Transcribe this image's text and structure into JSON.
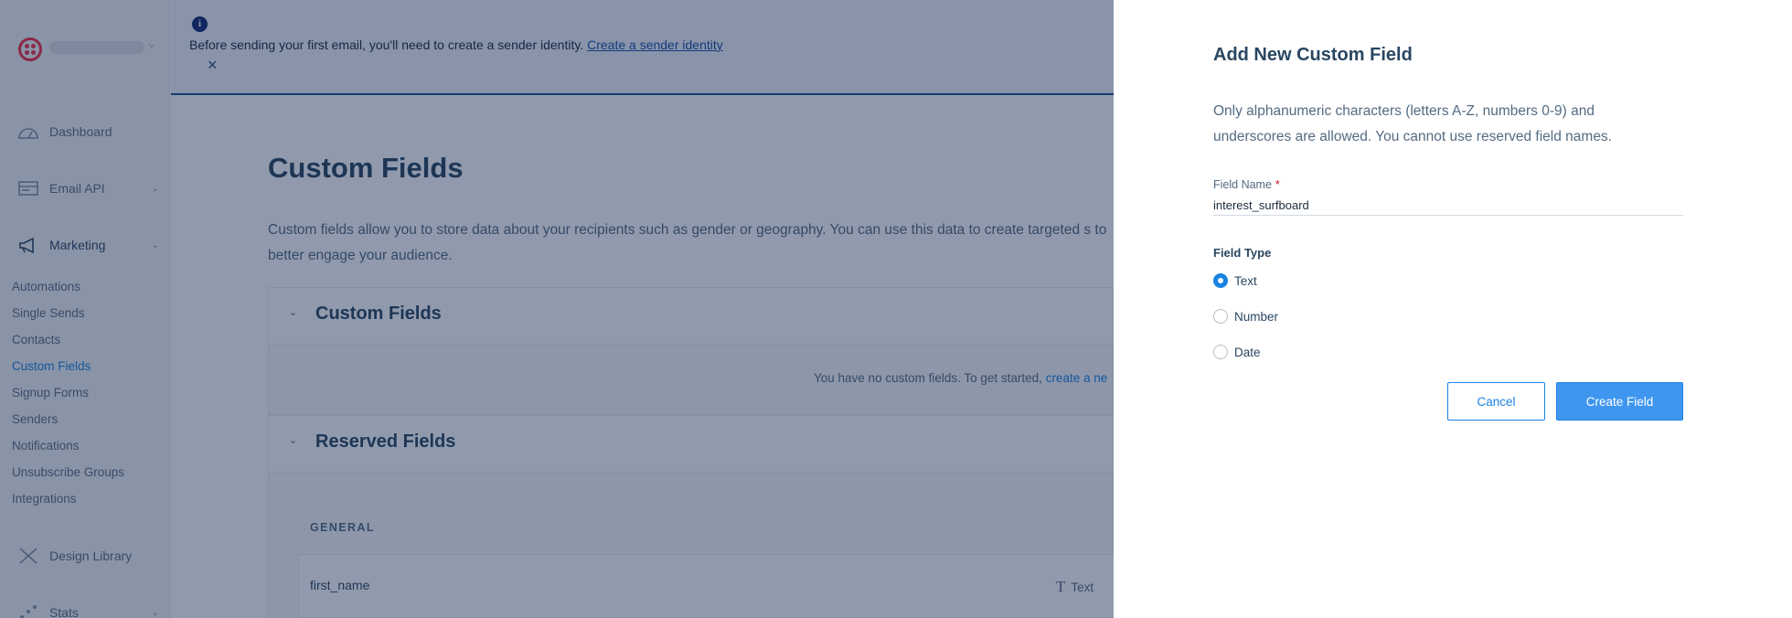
{
  "banner": {
    "message": "Before sending your first email, you'll need to create a sender identity.",
    "link": "Create a sender identity",
    "close_icon": "×"
  },
  "sidebar": {
    "top_items": [
      {
        "label": "Dashboard",
        "icon": "dashboard-icon"
      },
      {
        "label": "Email API",
        "icon": "email-api-icon"
      },
      {
        "label": "Marketing",
        "icon": "megaphone-icon"
      }
    ],
    "marketing_items": [
      {
        "label": "Automations"
      },
      {
        "label": "Single Sends"
      },
      {
        "label": "Contacts"
      },
      {
        "label": "Custom Fields",
        "selected": true
      },
      {
        "label": "Signup Forms"
      },
      {
        "label": "Senders"
      },
      {
        "label": "Notifications"
      },
      {
        "label": "Unsubscribe Groups"
      },
      {
        "label": "Integrations"
      }
    ],
    "bottom_items": [
      {
        "label": "Design Library",
        "icon": "design-library-icon"
      },
      {
        "label": "Stats",
        "icon": "stats-icon"
      }
    ]
  },
  "main": {
    "title": "Custom Fields",
    "description": "Custom fields allow you to store data about your recipients such as gender or geography. You can use this data to create targeted s to better engage your audience.",
    "custom_panel": {
      "title": "Custom Fields",
      "empty_text": "You have no custom fields. To get started,",
      "empty_link": "create a ne"
    },
    "reserved_panel": {
      "title": "Reserved Fields",
      "section_label": "GENERAL",
      "rows": [
        {
          "name": "first_name",
          "type": "Text"
        }
      ]
    }
  },
  "drawer": {
    "title": "Add New Custom Field",
    "description": "Only alphanumeric characters (letters A-Z, numbers 0-9) and underscores are allowed. You cannot use reserved field names.",
    "field_name_label": "Field Name",
    "field_name_required": "*",
    "field_name_value": "interest_surfboard",
    "field_type_label": "Field Type",
    "field_type_options": [
      {
        "label": "Text",
        "checked": true
      },
      {
        "label": "Number",
        "checked": false
      },
      {
        "label": "Date",
        "checked": false
      }
    ],
    "cancel_label": "Cancel",
    "create_label": "Create Field"
  },
  "colors": {
    "accent": "#1a82e2",
    "overlay": "rgba(15,35,75,0.46)",
    "brand": "#f22f46"
  }
}
